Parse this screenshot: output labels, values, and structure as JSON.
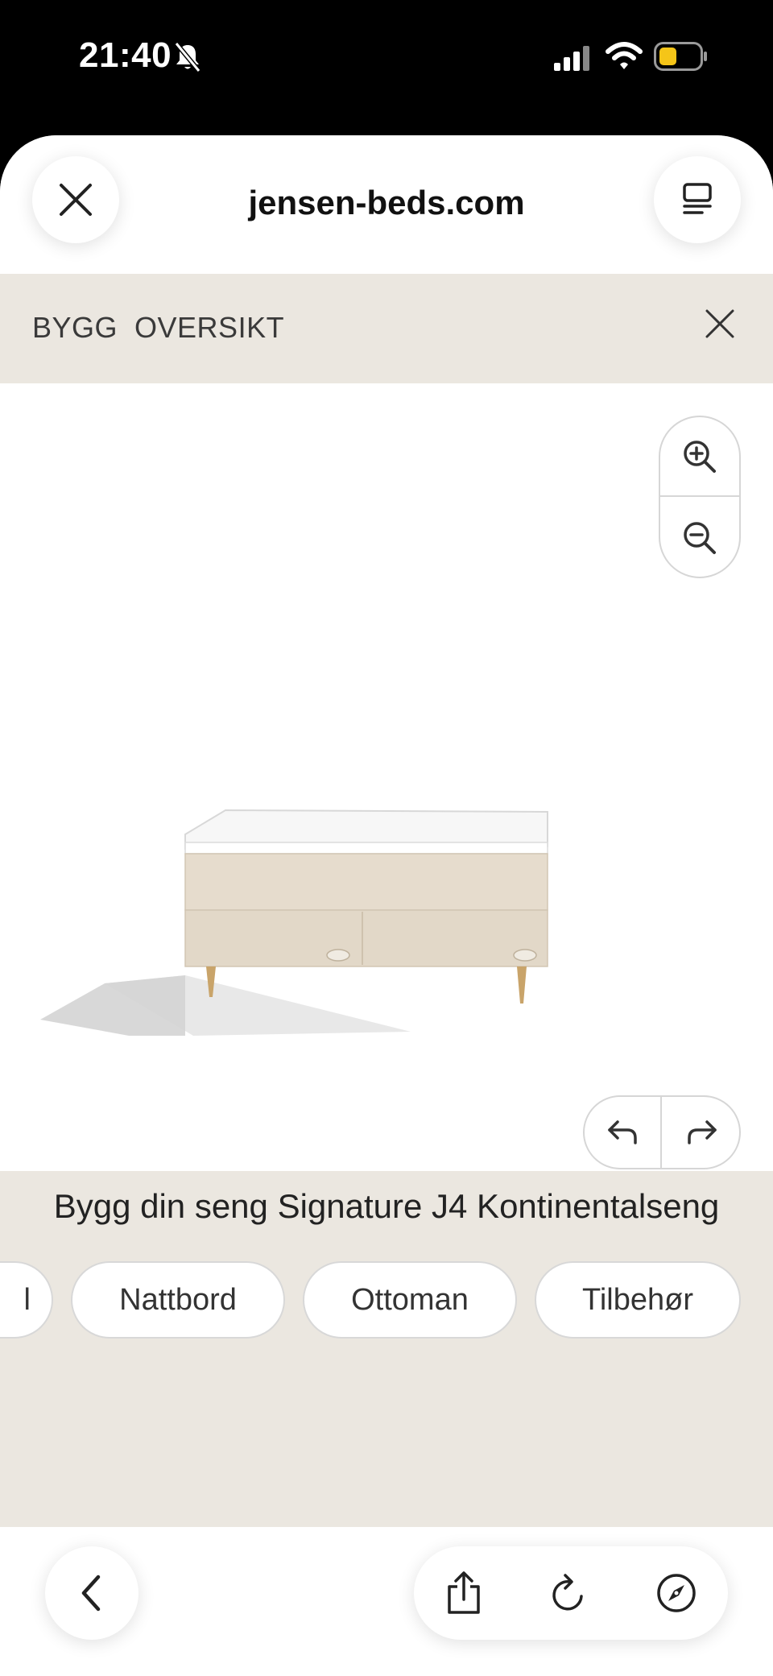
{
  "status_bar": {
    "time": "21:40",
    "icons": [
      "bell-slash-icon",
      "cellular-signal-icon",
      "wifi-icon",
      "battery-icon"
    ],
    "battery_color": "#f5c518"
  },
  "browser": {
    "url": "jensen-beds.com",
    "icons": [
      "close-icon",
      "tabs-icon",
      "chevron-left-icon",
      "share-icon",
      "reload-icon",
      "compass-icon"
    ]
  },
  "builder": {
    "header_title": "BYGG  OVERSIKT",
    "product_title": "Bygg din seng Signature J4 Kontinentalseng",
    "categories": [
      {
        "label": "l"
      },
      {
        "label": "Nattbord"
      },
      {
        "label": "Ottoman"
      },
      {
        "label": "Tilbehør"
      }
    ],
    "viewer_controls": [
      "zoom-in-icon",
      "zoom-out-icon",
      "undo-icon",
      "redo-icon"
    ],
    "colors": {
      "panel_background": "#ebe7e0",
      "bed_fabric": "#e6dccd",
      "bed_legs": "#c9a46a"
    }
  }
}
